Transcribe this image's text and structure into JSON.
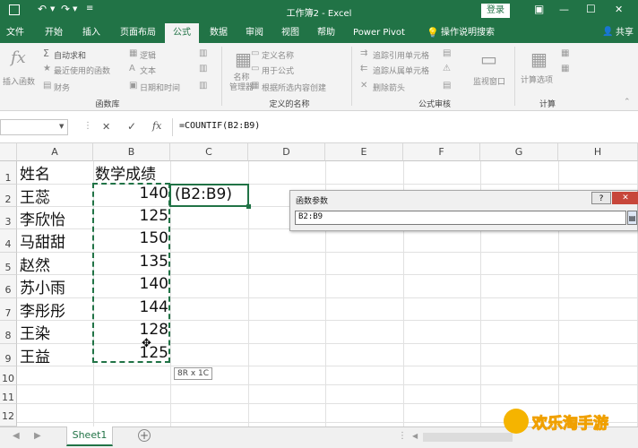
{
  "app": {
    "title": "工作簿2  -  Excel",
    "login_label": "登录",
    "share_label": "共享",
    "window_controls": {
      "ribbon_display": "▣",
      "minimize": "—",
      "maximize": "☐",
      "close": "✕"
    }
  },
  "quick_access": {
    "save_icon": "save-icon",
    "undo_icon": "undo-icon",
    "redo_icon": "redo-icon",
    "customize_icon": "customize-icon"
  },
  "tabs": [
    {
      "label": "文件",
      "active": false
    },
    {
      "label": "开始",
      "active": false
    },
    {
      "label": "插入",
      "active": false
    },
    {
      "label": "页面布局",
      "active": false
    },
    {
      "label": "公式",
      "active": true
    },
    {
      "label": "数据",
      "active": false
    },
    {
      "label": "审阅",
      "active": false
    },
    {
      "label": "视图",
      "active": false
    },
    {
      "label": "帮助",
      "active": false
    },
    {
      "label": "Power Pivot",
      "active": false
    }
  ],
  "tell_me": "操作说明搜索",
  "ribbon": {
    "insert_function": "插入函数",
    "autosum": "自动求和",
    "recent": "最近使用的函数",
    "financial": "财务",
    "logical": "逻辑",
    "text": "文本",
    "datetime": "日期和时间",
    "group_function_library": "函数库",
    "name_manager": "名称\n管理器",
    "define_name": "定义名称",
    "use_in_formula": "用于公式",
    "create_from_selection": "根据所选内容创建",
    "group_defined_names": "定义的名称",
    "trace_precedents": "追踪引用单元格",
    "trace_dependents": "追踪从属单元格",
    "remove_arrows": "删除箭头",
    "group_formula_auditing": "公式审核",
    "watch_window": "监视窗口",
    "calc_options": "计算选项",
    "group_calculation": "计算"
  },
  "formula_bar": {
    "name_box": "",
    "cancel": "✕",
    "enter": "✓",
    "fx": "fx",
    "formula": "=COUNTIF(B2:B9)"
  },
  "columns": [
    "A",
    "B",
    "C",
    "D",
    "E",
    "F",
    "G",
    "H"
  ],
  "rows": [
    "1",
    "2",
    "3",
    "4",
    "5",
    "6",
    "7",
    "8",
    "9",
    "10",
    "11",
    "12"
  ],
  "cells": {
    "A1": "姓名",
    "B1": "数学成绩",
    "A2": "王蕊",
    "B2": "140",
    "A3": "李欣怡",
    "B3": "125",
    "A4": "马甜甜",
    "B4": "150",
    "A5": "赵然",
    "B5": "135",
    "A6": "苏小雨",
    "B6": "140",
    "A7": "李彤彤",
    "B7": "144",
    "A8": "王染",
    "B8": "128",
    "A9": "王益",
    "B9": "125",
    "C2": "(B2:B9)"
  },
  "range_tooltip": "8R x 1C",
  "dialog": {
    "title": "函数参数",
    "help": "?",
    "close": "✕",
    "value": "B2:B9"
  },
  "sheet_tabs": [
    {
      "label": "Sheet1",
      "active": true
    }
  ],
  "add_sheet": "+",
  "watermark": "欢乐淘手游"
}
